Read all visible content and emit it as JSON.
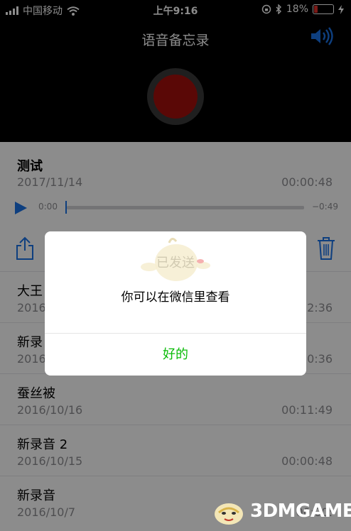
{
  "status": {
    "carrier": "中国移动",
    "time": "上午9:16",
    "battery": "18%",
    "battery_level": 0.18
  },
  "header": {
    "title": "语音备忘录"
  },
  "current": {
    "title": "测试",
    "date": "2017/11/14",
    "duration": "00:00:48",
    "time_start": "0:00",
    "time_end": "−0:49",
    "progress": 0.0
  },
  "recordings": [
    {
      "title": "大王",
      "date": "2016",
      "duration": "2:36"
    },
    {
      "title": "新录",
      "date": "2016",
      "duration": "0:36"
    },
    {
      "title": "蚕丝被",
      "date": "2016/10/16",
      "duration": "00:11:49"
    },
    {
      "title": "新录音 2",
      "date": "2016/10/15",
      "duration": "00:00:48"
    },
    {
      "title": "新录音",
      "date": "2016/10/7",
      "duration": "00:00:"
    }
  ],
  "dialog": {
    "title": "已发送",
    "message": "你可以在微信里查看",
    "button": "好的"
  },
  "watermark": {
    "text": "3DMGAME"
  },
  "colors": {
    "accent": "#1a73e8",
    "record": "#a4100c",
    "wechat_green": "#09bb07",
    "battery_low": "#e0302a"
  }
}
